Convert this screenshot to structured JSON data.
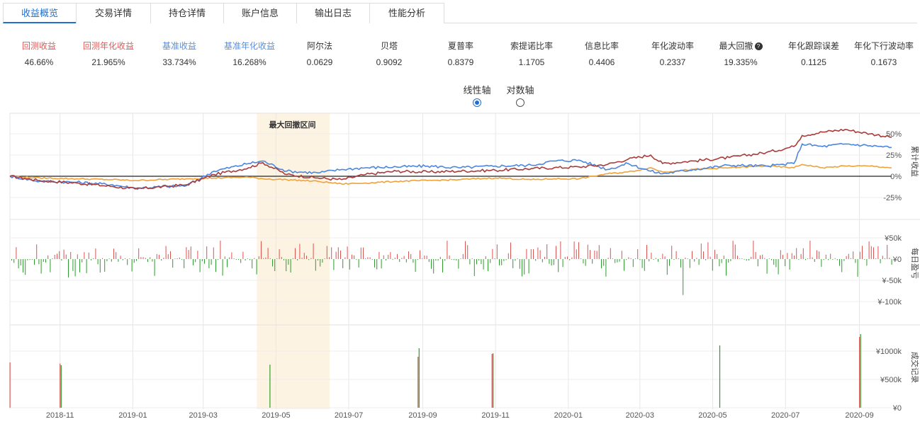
{
  "tabs": [
    {
      "label": "收益概览",
      "active": true
    },
    {
      "label": "交易详情",
      "active": false
    },
    {
      "label": "持仓详情",
      "active": false
    },
    {
      "label": "账户信息",
      "active": false
    },
    {
      "label": "输出日志",
      "active": false
    },
    {
      "label": "性能分析",
      "active": false
    }
  ],
  "metrics": [
    {
      "label": "回测收益",
      "value": "46.66%",
      "color": "#e15a5a"
    },
    {
      "label": "回测年化收益",
      "value": "21.965%",
      "color": "#e15a5a"
    },
    {
      "label": "基准收益",
      "value": "33.734%",
      "color": "#5b8fdc"
    },
    {
      "label": "基准年化收益",
      "value": "16.268%",
      "color": "#5b8fdc"
    },
    {
      "label": "阿尔法",
      "value": "0.0629",
      "color": "#333333"
    },
    {
      "label": "贝塔",
      "value": "0.9092",
      "color": "#333333"
    },
    {
      "label": "夏普率",
      "value": "0.8379",
      "color": "#333333"
    },
    {
      "label": "索提诺比率",
      "value": "1.1705",
      "color": "#333333"
    },
    {
      "label": "信息比率",
      "value": "0.4406",
      "color": "#333333"
    },
    {
      "label": "年化波动率",
      "value": "0.2337",
      "color": "#333333"
    },
    {
      "label": "最大回撤",
      "value": "19.335%",
      "color": "#333333",
      "help": "?"
    },
    {
      "label": "年化跟踪误差",
      "value": "0.1125",
      "color": "#333333"
    },
    {
      "label": "年化下行波动率",
      "value": "0.1673",
      "color": "#333333"
    }
  ],
  "axis_toggle": {
    "linear_label": "线性轴",
    "log_label": "对数轴",
    "selected": "linear"
  },
  "colors": {
    "strategy": "#a83c3c",
    "benchmark": "#4b86e0",
    "excess": "#f0a23a",
    "profit_bar": "#d9534f",
    "loss_bar": "#2e9b2e",
    "drawdown_band": "#fdf3e3"
  },
  "chart_data": [
    {
      "type": "line",
      "ylabel": "累计收益",
      "yticks": [
        "50%",
        "25%",
        "0%",
        "-25%"
      ],
      "ylim": [
        -30,
        60
      ],
      "annotation": "最大回撤区间",
      "drawdown_range": [
        "2019-04-15",
        "2019-06-15"
      ],
      "xticks": [
        "2018-11",
        "2019-01",
        "2019-03",
        "2019-05",
        "2019-07",
        "2019-09",
        "2019-11",
        "2020-01",
        "2020-03",
        "2020-05",
        "2020-07",
        "2020-09"
      ],
      "x": [
        "2018-09-20",
        "2018-10-15",
        "2018-11-15",
        "2018-12-15",
        "2019-01-03",
        "2019-02-15",
        "2019-03-10",
        "2019-04-08",
        "2019-04-20",
        "2019-05-10",
        "2019-06-05",
        "2019-06-25",
        "2019-07-15",
        "2019-08-10",
        "2019-09-05",
        "2019-10-01",
        "2019-11-01",
        "2019-12-01",
        "2019-12-20",
        "2020-01-10",
        "2020-02-03",
        "2020-02-20",
        "2020-03-10",
        "2020-03-20",
        "2020-04-15",
        "2020-05-15",
        "2020-06-15",
        "2020-07-08",
        "2020-07-15",
        "2020-08-01",
        "2020-08-20",
        "2020-09-10",
        "2020-09-28"
      ],
      "series": [
        {
          "values": [
            0,
            -5,
            -8,
            -12,
            -15,
            -10,
            2,
            10,
            16,
            2,
            -2,
            -4,
            2,
            6,
            5,
            6,
            7,
            9,
            10,
            11,
            14,
            20,
            25,
            15,
            18,
            22,
            28,
            35,
            48,
            52,
            55,
            50,
            46
          ]
        },
        {
          "values": [
            0,
            -6,
            -7,
            -10,
            -14,
            -11,
            6,
            15,
            18,
            6,
            4,
            8,
            10,
            11,
            12,
            10,
            12,
            13,
            18,
            19,
            8,
            15,
            6,
            3,
            8,
            13,
            12,
            15,
            38,
            35,
            38,
            36,
            34
          ]
        },
        {
          "values": [
            0,
            -2,
            -3,
            -4,
            -5,
            -3,
            -2,
            -1,
            -3,
            -4,
            -6,
            -9,
            -8,
            -6,
            -5,
            -4,
            -2,
            -4,
            -3,
            -3,
            3,
            5,
            10,
            5,
            8,
            10,
            12,
            10,
            14,
            10,
            12,
            12,
            10
          ]
        }
      ]
    },
    {
      "type": "bar",
      "ylabel": "每日盈亏",
      "yticks": [
        "¥50k",
        "¥0",
        "¥-50k",
        "¥-100k"
      ],
      "ylim": [
        -100000,
        50000
      ]
    },
    {
      "type": "bar",
      "ylabel": "成交记录",
      "yticks": [
        "¥1000k",
        "¥500k",
        "¥0"
      ],
      "ylim": [
        0,
        1350000
      ],
      "trades": [
        {
          "date": "2018-09-20",
          "buy": 800000,
          "sell": 0
        },
        {
          "date": "2018-11-01",
          "buy": 780000,
          "sell": 750000
        },
        {
          "date": "2019-04-25",
          "buy": 0,
          "sell": 760000
        },
        {
          "date": "2019-08-28",
          "buy": 900000,
          "sell": 1050000
        },
        {
          "date": "2019-10-29",
          "buy": 950000,
          "sell": 960000
        },
        {
          "date": "2020-05-06",
          "buy": 0,
          "sell": 1100000
        },
        {
          "date": "2020-09-01",
          "buy": 1250000,
          "sell": 1300000
        }
      ]
    }
  ]
}
